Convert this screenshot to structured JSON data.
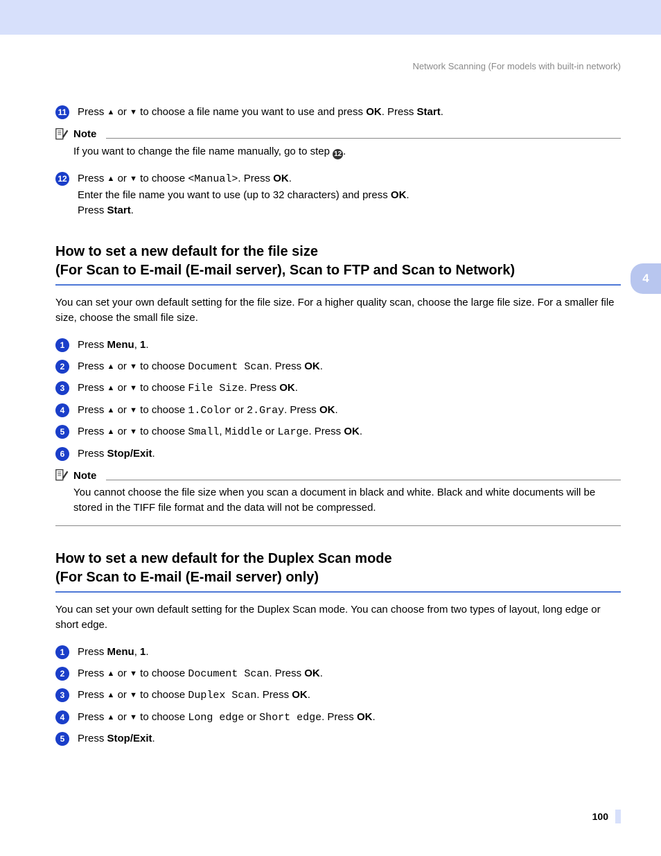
{
  "header": "Network Scanning (For models with built-in network)",
  "chapter_tab": "4",
  "page_number": "100",
  "top_steps": [
    {
      "n": "11",
      "parts": [
        {
          "t": "Press "
        },
        {
          "t": "▲",
          "cls": "arrow"
        },
        {
          "t": " or "
        },
        {
          "t": "▼",
          "cls": "arrow"
        },
        {
          "t": " to choose a file name you want to use and press "
        },
        {
          "t": "OK",
          "b": true
        },
        {
          "t": ". Press "
        },
        {
          "t": "Start",
          "b": true
        },
        {
          "t": "."
        }
      ]
    }
  ],
  "note1": {
    "label": "Note",
    "body_parts": [
      {
        "t": "If you want to change the file name manually, go to step "
      },
      {
        "t": "12",
        "badge": true
      },
      {
        "t": "."
      }
    ]
  },
  "step12": {
    "n": "12",
    "lines": [
      [
        {
          "t": "Press "
        },
        {
          "t": "▲",
          "cls": "arrow"
        },
        {
          "t": " or "
        },
        {
          "t": "▼",
          "cls": "arrow"
        },
        {
          "t": " to choose "
        },
        {
          "t": "<Manual>",
          "cls": "mono"
        },
        {
          "t": ". Press "
        },
        {
          "t": "OK",
          "b": true
        },
        {
          "t": "."
        }
      ],
      [
        {
          "t": "Enter the file name you want to use (up to 32 characters) and press "
        },
        {
          "t": "OK",
          "b": true
        },
        {
          "t": "."
        }
      ],
      [
        {
          "t": "Press "
        },
        {
          "t": "Start",
          "b": true
        },
        {
          "t": "."
        }
      ]
    ]
  },
  "section1": {
    "title_lines": [
      "How to set a new default for the file size",
      "(For Scan to E-mail (E-mail server), Scan to FTP and Scan to Network)"
    ],
    "intro": "You can set your own default setting for the file size. For a higher quality scan, choose the large file size. For a smaller file size, choose the small file size.",
    "steps": [
      {
        "n": "1",
        "parts": [
          {
            "t": "Press "
          },
          {
            "t": "Menu",
            "b": true
          },
          {
            "t": ", "
          },
          {
            "t": "1",
            "b": true
          },
          {
            "t": "."
          }
        ]
      },
      {
        "n": "2",
        "parts": [
          {
            "t": "Press "
          },
          {
            "t": "▲",
            "cls": "arrow"
          },
          {
            "t": " or "
          },
          {
            "t": "▼",
            "cls": "arrow"
          },
          {
            "t": " to choose "
          },
          {
            "t": "Document Scan",
            "cls": "mono"
          },
          {
            "t": ". Press "
          },
          {
            "t": "OK",
            "b": true
          },
          {
            "t": "."
          }
        ]
      },
      {
        "n": "3",
        "parts": [
          {
            "t": "Press "
          },
          {
            "t": "▲",
            "cls": "arrow"
          },
          {
            "t": " or "
          },
          {
            "t": "▼",
            "cls": "arrow"
          },
          {
            "t": " to choose "
          },
          {
            "t": "File Size",
            "cls": "mono"
          },
          {
            "t": ". Press "
          },
          {
            "t": "OK",
            "b": true
          },
          {
            "t": "."
          }
        ]
      },
      {
        "n": "4",
        "parts": [
          {
            "t": "Press "
          },
          {
            "t": "▲",
            "cls": "arrow"
          },
          {
            "t": " or "
          },
          {
            "t": "▼",
            "cls": "arrow"
          },
          {
            "t": " to choose "
          },
          {
            "t": "1.Color",
            "cls": "mono"
          },
          {
            "t": " or "
          },
          {
            "t": "2.Gray",
            "cls": "mono"
          },
          {
            "t": ". Press "
          },
          {
            "t": "OK",
            "b": true
          },
          {
            "t": "."
          }
        ]
      },
      {
        "n": "5",
        "parts": [
          {
            "t": "Press "
          },
          {
            "t": "▲",
            "cls": "arrow"
          },
          {
            "t": " or "
          },
          {
            "t": "▼",
            "cls": "arrow"
          },
          {
            "t": " to choose "
          },
          {
            "t": "Small",
            "cls": "mono"
          },
          {
            "t": ", "
          },
          {
            "t": "Middle",
            "cls": "mono"
          },
          {
            "t": " or "
          },
          {
            "t": "Large",
            "cls": "mono"
          },
          {
            "t": ". Press "
          },
          {
            "t": "OK",
            "b": true
          },
          {
            "t": "."
          }
        ]
      },
      {
        "n": "6",
        "parts": [
          {
            "t": "Press "
          },
          {
            "t": "Stop/Exit",
            "b": true
          },
          {
            "t": "."
          }
        ]
      }
    ],
    "note": {
      "label": "Note",
      "body": "You cannot choose the file size when you scan a document in black and white. Black and white documents will be stored in the TIFF file format and the data will not be compressed."
    }
  },
  "section2": {
    "title_lines": [
      "How to set a new default for the Duplex Scan mode",
      " (For Scan to E-mail (E-mail server) only)"
    ],
    "intro": "You can set your own default setting for the Duplex Scan mode. You can choose from two types of layout, long edge or short edge.",
    "steps": [
      {
        "n": "1",
        "parts": [
          {
            "t": "Press "
          },
          {
            "t": "Menu",
            "b": true
          },
          {
            "t": ", "
          },
          {
            "t": "1",
            "b": true
          },
          {
            "t": "."
          }
        ]
      },
      {
        "n": "2",
        "parts": [
          {
            "t": "Press "
          },
          {
            "t": "▲",
            "cls": "arrow"
          },
          {
            "t": " or "
          },
          {
            "t": "▼",
            "cls": "arrow"
          },
          {
            "t": " to choose "
          },
          {
            "t": "Document Scan",
            "cls": "mono"
          },
          {
            "t": ". Press "
          },
          {
            "t": "OK",
            "b": true
          },
          {
            "t": "."
          }
        ]
      },
      {
        "n": "3",
        "parts": [
          {
            "t": "Press "
          },
          {
            "t": "▲",
            "cls": "arrow"
          },
          {
            "t": " or "
          },
          {
            "t": "▼",
            "cls": "arrow"
          },
          {
            "t": " to choose "
          },
          {
            "t": "Duplex Scan",
            "cls": "mono"
          },
          {
            "t": ". Press "
          },
          {
            "t": "OK",
            "b": true
          },
          {
            "t": "."
          }
        ]
      },
      {
        "n": "4",
        "parts": [
          {
            "t": "Press "
          },
          {
            "t": "▲",
            "cls": "arrow"
          },
          {
            "t": " or "
          },
          {
            "t": "▼",
            "cls": "arrow"
          },
          {
            "t": " to choose "
          },
          {
            "t": "Long edge",
            "cls": "mono"
          },
          {
            "t": " or "
          },
          {
            "t": "Short edge",
            "cls": "mono"
          },
          {
            "t": ". Press "
          },
          {
            "t": "OK",
            "b": true
          },
          {
            "t": "."
          }
        ]
      },
      {
        "n": "5",
        "parts": [
          {
            "t": "Press "
          },
          {
            "t": "Stop/Exit",
            "b": true
          },
          {
            "t": "."
          }
        ]
      }
    ]
  }
}
